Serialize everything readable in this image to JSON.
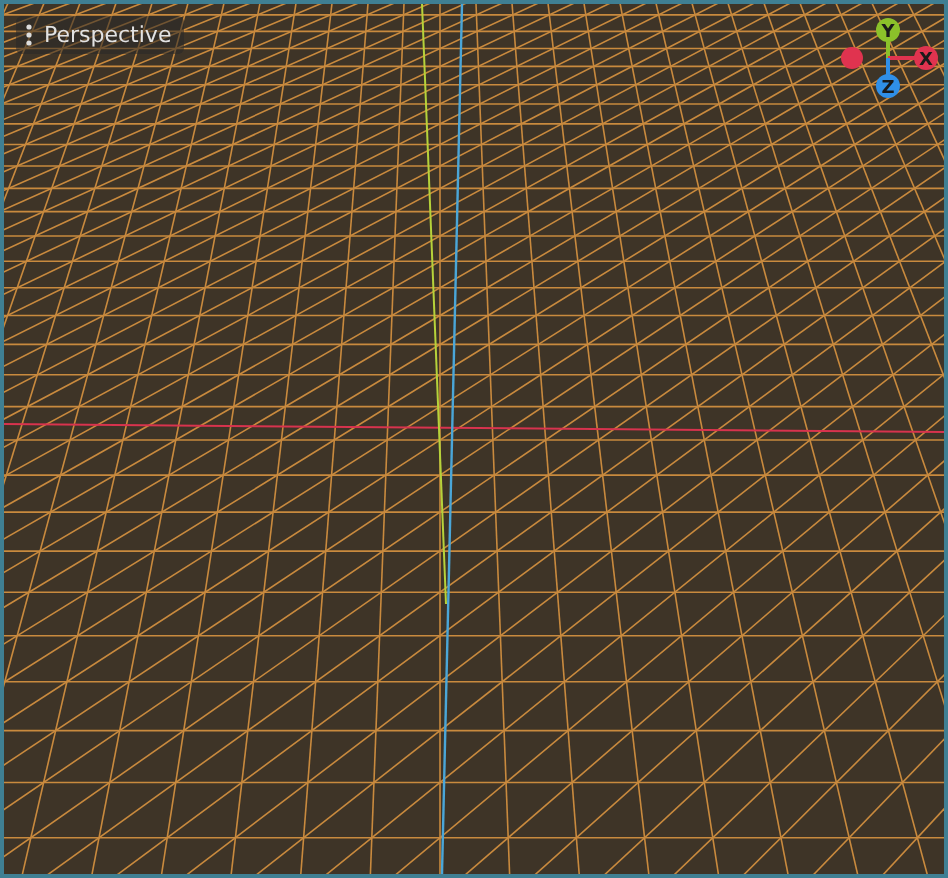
{
  "viewport": {
    "view_menu": {
      "label": "Perspective"
    },
    "gizmo": {
      "axes": [
        {
          "label": "Y",
          "color": "#8bc12a"
        },
        {
          "label": "X",
          "color": "#e0334f"
        },
        {
          "label": "Z",
          "color": "#2f8fe8"
        }
      ]
    }
  }
}
